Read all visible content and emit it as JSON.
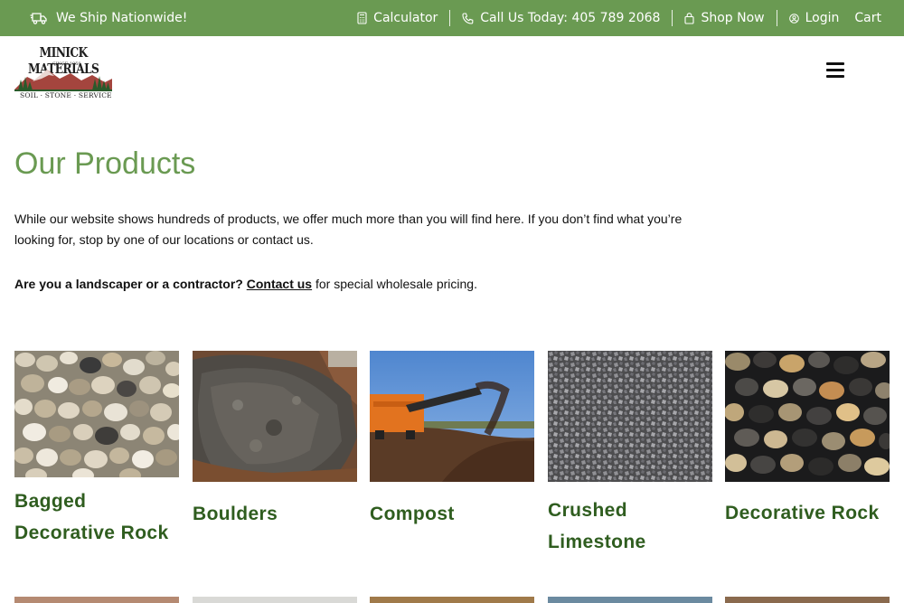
{
  "topbar": {
    "ship_label": "We Ship Nationwide!",
    "calculator_label": "Calculator",
    "phone_label": "Call Us Today: 405 789 2068",
    "shop_label": "Shop Now",
    "login_label": "Login",
    "cart_label": "Cart"
  },
  "logo": {
    "name": "MINICK MATERIALS",
    "since": "SINCE 1950",
    "tagline": "SOIL · STONE · SERVICE"
  },
  "main": {
    "title": "Our Products",
    "intro": "While our website shows hundreds of products, we offer much more than you will find here. If you don’t find what you’re looking for, stop by one of our locations or contact us.",
    "wholesale_bold": "Are you a landscaper or a contractor?",
    "wholesale_link": "Contact us",
    "wholesale_rest": " for special wholesale pricing."
  },
  "products": [
    {
      "name": "Bagged Decorative Rock"
    },
    {
      "name": "Boulders"
    },
    {
      "name": "Compost"
    },
    {
      "name": "Crushed Limestone"
    },
    {
      "name": "Decorative Rock"
    }
  ],
  "colors": {
    "brand_green": "#6a9a52",
    "product_title_green": "#2f5d1f"
  },
  "icons": {
    "ship": "truck-icon",
    "calculator": "calculator-icon",
    "phone": "phone-icon",
    "shop": "shopping-bag-icon",
    "login": "user-icon",
    "menu": "hamburger-menu-icon"
  }
}
